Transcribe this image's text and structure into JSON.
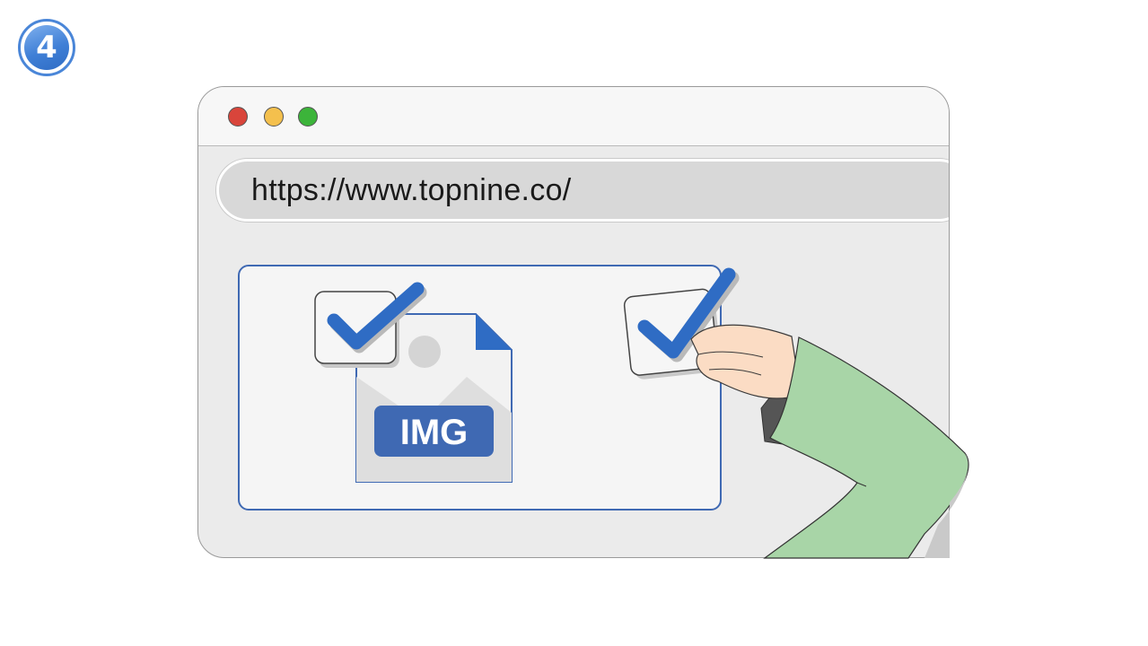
{
  "step": {
    "number": "4"
  },
  "browser": {
    "window_controls": [
      "close",
      "minimize",
      "maximize"
    ],
    "address_bar": {
      "url": "https://www.topnine.co/"
    }
  },
  "content": {
    "file": {
      "label": "IMG",
      "icon": "image-file-icon"
    },
    "checkboxes": [
      {
        "icon": "checkbox-checked-icon",
        "checked": true
      },
      {
        "icon": "checkbox-checked-icon",
        "checked": true
      }
    ],
    "hand": {
      "icon": "hand-pointer-icon"
    }
  },
  "colors": {
    "accent_blue": "#2f6cc4",
    "panel_border": "#3f69b3",
    "file_fill": "#e6e6e6",
    "sleeve_green": "#a8d5a7",
    "skin": "#fbdcc4",
    "dot_red": "#d9453b",
    "dot_yellow": "#f4c04d",
    "dot_green": "#3cb43a"
  }
}
